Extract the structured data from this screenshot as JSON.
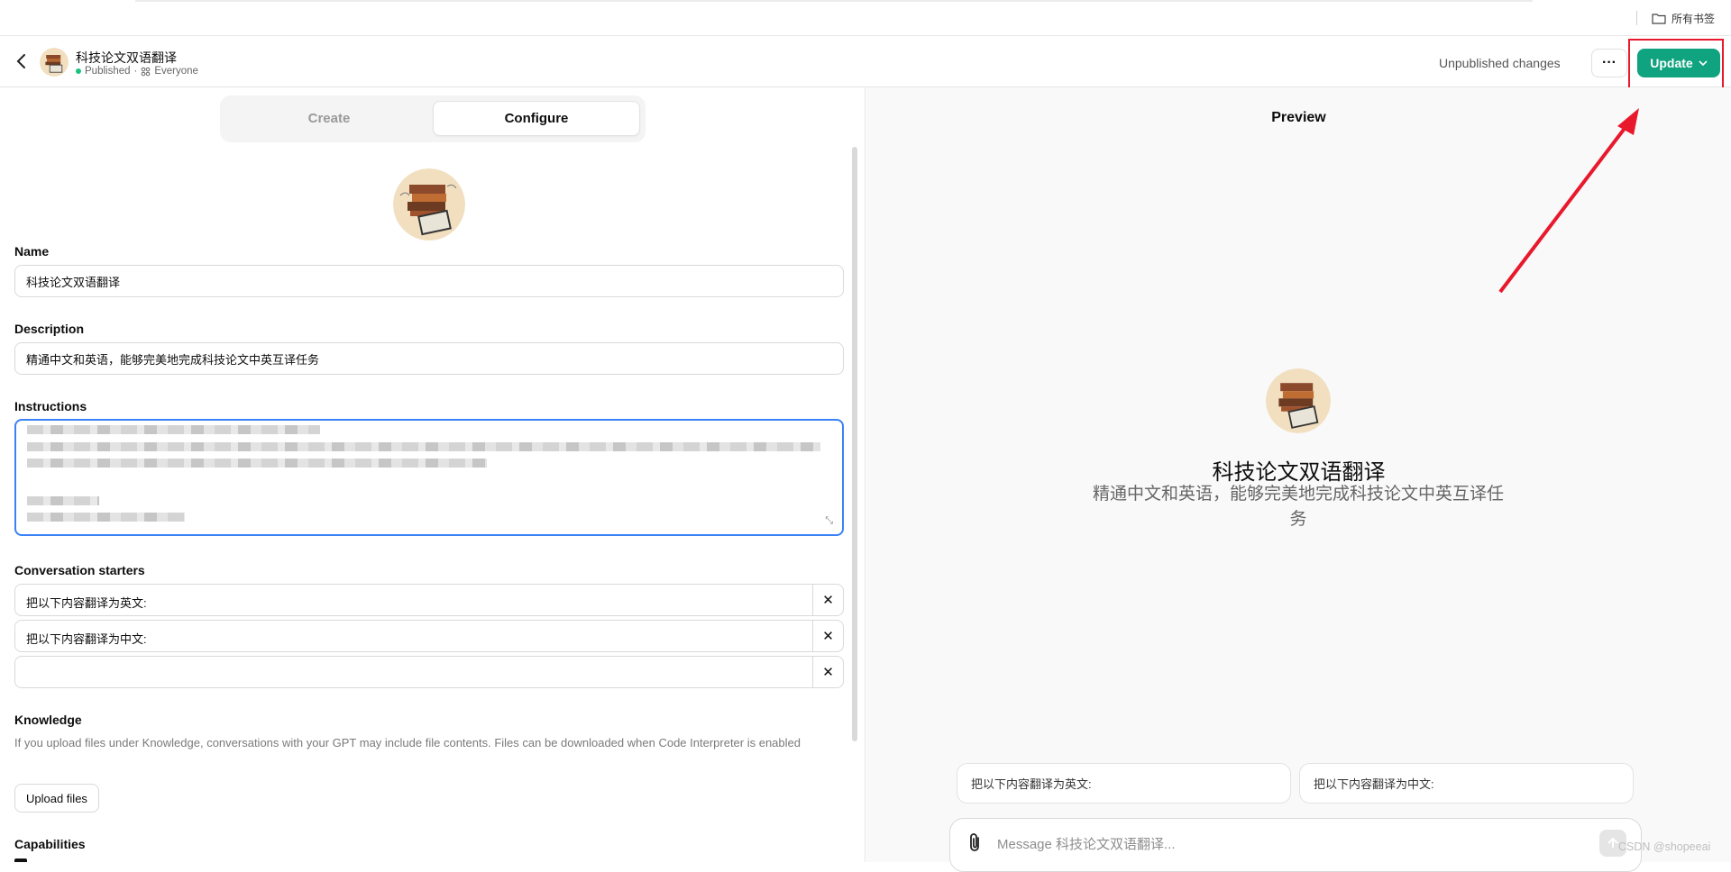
{
  "browser": {
    "bookmarks_folder": "所有书签"
  },
  "header": {
    "gpt_name": "科技论文双语翻译",
    "status_published": "Published",
    "status_sep": "·",
    "status_audience": "Everyone",
    "unpublished": "Unpublished changes",
    "more_label": "···",
    "update_label": "Update"
  },
  "tabs": {
    "create": "Create",
    "configure": "Configure"
  },
  "form": {
    "name_label": "Name",
    "name_value": "科技论文双语翻译",
    "description_label": "Description",
    "description_value": "精通中文和英语，能够完美地完成科技论文中英互译任务",
    "instructions_label": "Instructions",
    "starters_label": "Conversation starters",
    "starters": [
      "把以下内容翻译为英文:",
      "把以下内容翻译为中文:",
      ""
    ],
    "knowledge_label": "Knowledge",
    "knowledge_desc": "If you upload files under Knowledge, conversations with your GPT may include file contents. Files can be downloaded when Code Interpreter is enabled",
    "upload_label": "Upload files",
    "capabilities_label": "Capabilities"
  },
  "preview": {
    "title": "Preview",
    "name": "科技论文双语翻译",
    "description": "精通中文和英语，能够完美地完成科技论文中英互译任务",
    "starters": [
      "把以下内容翻译为英文:",
      "把以下内容翻译为中文:"
    ],
    "message_placeholder": "Message 科技论文双语翻译..."
  },
  "watermark": "CSDN @shopeeai",
  "colors": {
    "accent": "#10a37f",
    "highlight": "#e8192c",
    "focus": "#3b82f6"
  }
}
